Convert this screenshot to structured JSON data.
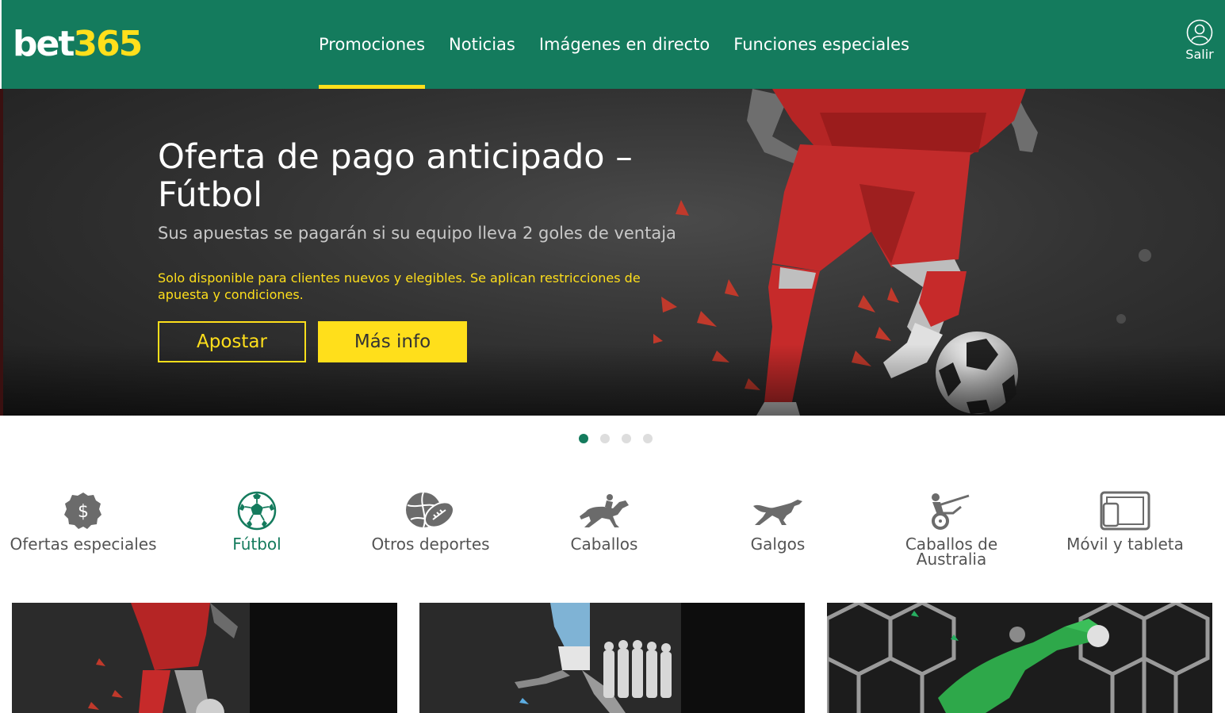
{
  "header": {
    "logo_white": "bet",
    "logo_yellow": "365",
    "nav": [
      {
        "label": "Promociones",
        "active": true
      },
      {
        "label": "Noticias",
        "active": false
      },
      {
        "label": "Imágenes en directo",
        "active": false
      },
      {
        "label": "Funciones especiales",
        "active": false
      }
    ],
    "user_label": "Salir"
  },
  "hero": {
    "title": "Oferta de pago anticipado – Fútbol",
    "subtitle": "Sus apuestas se pagarán si su equipo lleva 2 goles de ventaja",
    "terms": "Solo disponible para clientes nuevos y elegibles. Se aplican restricciones de apuesta y condiciones.",
    "primary_button": "Apostar",
    "secondary_button": "Más info"
  },
  "carousel": {
    "total": 4,
    "active_index": 0
  },
  "categories": [
    {
      "label": "Ofertas especiales",
      "icon": "dollar-badge-icon",
      "active": false
    },
    {
      "label": "Fútbol",
      "icon": "soccer-ball-icon",
      "active": true
    },
    {
      "label": "Otros deportes",
      "icon": "other-sports-icon",
      "active": false
    },
    {
      "label": "Caballos",
      "icon": "horse-racing-icon",
      "active": false
    },
    {
      "label": "Galgos",
      "icon": "greyhound-icon",
      "active": false
    },
    {
      "label": "Caballos de Australia",
      "icon": "harness-racing-icon",
      "active": false
    },
    {
      "label": "Móvil y tableta",
      "icon": "mobile-tablet-icon",
      "active": false
    }
  ],
  "colors": {
    "brand_green": "#147b5d",
    "accent_yellow": "#ffdf1b",
    "text_grey": "#545454"
  }
}
